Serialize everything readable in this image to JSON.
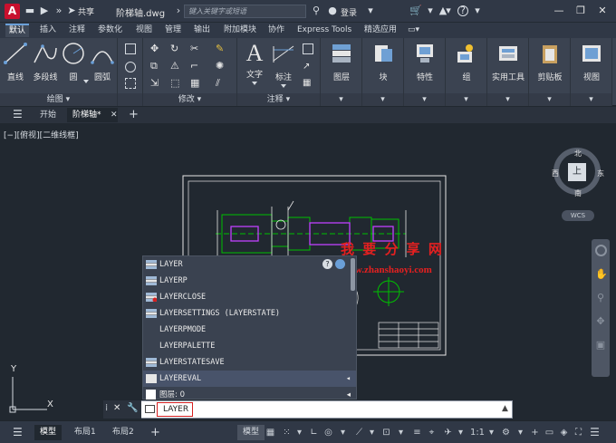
{
  "titlebar": {
    "app_letter": "A",
    "share": "共享",
    "doc_title": "阶梯轴.dwg",
    "search_placeholder": "键入关键字或短语",
    "login": "登录",
    "help": "?"
  },
  "ribbon_tabs": [
    "默认",
    "插入",
    "注释",
    "参数化",
    "视图",
    "管理",
    "输出",
    "附加模块",
    "协作",
    "Express Tools",
    "精选应用"
  ],
  "ribbon": {
    "draw": {
      "footer": "绘图",
      "buttons": [
        "直线",
        "多段线",
        "圆",
        "圆弧"
      ]
    },
    "modify": {
      "footer": "修改"
    },
    "annotation": {
      "footer": "注释",
      "buttons": [
        "文字",
        "标注"
      ]
    },
    "big_buttons": [
      "图层",
      "块",
      "特性",
      "组",
      "实用工具",
      "剪贴板",
      "视图"
    ]
  },
  "doc_tabs": [
    "开始",
    "阶梯轴*"
  ],
  "canvas": {
    "view_label": "[−][俯视][二维线框]",
    "viewcube": {
      "north": "北",
      "south": "南",
      "east": "东",
      "west": "西",
      "top": "上",
      "wcs": "WCS"
    },
    "axis_x": "X",
    "axis_y": "Y"
  },
  "watermark": {
    "title": "我 要 分 享 网",
    "url": "www.zhanshaoyi.com"
  },
  "autocomplete": {
    "items": [
      {
        "label": "LAYER"
      },
      {
        "label": "LAYERP"
      },
      {
        "label": "LAYERCLOSE"
      },
      {
        "label": "LAYERSETTINGS (LAYERSTATE)"
      },
      {
        "label": "LAYERPMODE"
      },
      {
        "label": "LAYERPALETTE"
      },
      {
        "label": "LAYERSTATESAVE"
      },
      {
        "label": "LAYEREVAL"
      },
      {
        "label": "图层: 0"
      }
    ]
  },
  "cmdline": {
    "value": "LAYER"
  },
  "statusbar": {
    "tabs": [
      "模型",
      "布局1",
      "布局2"
    ],
    "model_btn": "模型",
    "scale": "1:1"
  },
  "colors": {
    "accent": "#6a9fd8",
    "logo": "#c8102e",
    "bg": "#212830",
    "highlight": "#d62020",
    "green": "#00c000",
    "magenta": "#c040ff"
  }
}
